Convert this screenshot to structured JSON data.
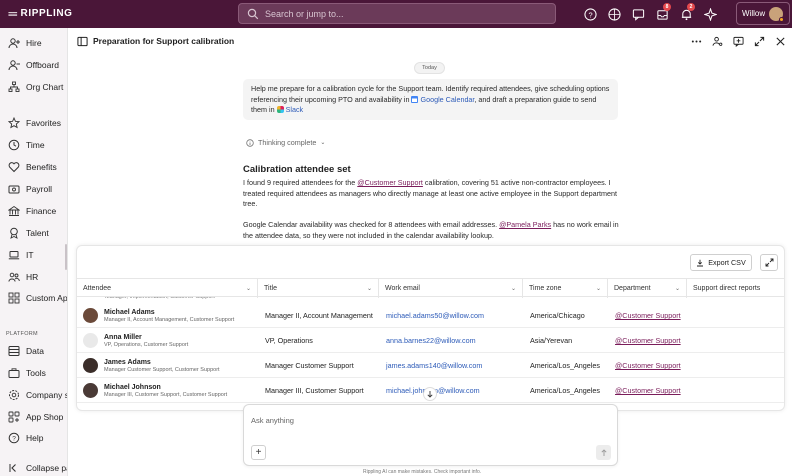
{
  "app": {
    "name": "RIPPLING",
    "logo_mark": "≡≡"
  },
  "search": {
    "placeholder": "Search or jump to..."
  },
  "top_icons": [
    {
      "icon": "help-icon"
    },
    {
      "icon": "globe-icon"
    },
    {
      "icon": "chat-icon"
    },
    {
      "icon": "inbox-icon",
      "badge": "8"
    },
    {
      "icon": "bell-icon",
      "badge": "2"
    },
    {
      "icon": "sparkle-icon"
    }
  ],
  "user": {
    "name": "Willow"
  },
  "sidebar": {
    "items": [
      {
        "label": "Hire",
        "icon": "hire-icon"
      },
      {
        "label": "Offboard",
        "icon": "offboard-icon"
      },
      {
        "label": "Org Chart",
        "icon": "org-chart-icon"
      },
      {
        "label": "Favorites",
        "icon": "star-icon"
      },
      {
        "label": "Time",
        "icon": "clock-icon"
      },
      {
        "label": "Benefits",
        "icon": "heart-icon"
      },
      {
        "label": "Payroll",
        "icon": "payroll-icon"
      },
      {
        "label": "Finance",
        "icon": "finance-icon"
      },
      {
        "label": "Talent",
        "icon": "talent-icon"
      },
      {
        "label": "IT",
        "icon": "laptop-icon"
      },
      {
        "label": "HR",
        "icon": "people-icon"
      },
      {
        "label": "Custom Apps",
        "icon": "grid-icon"
      }
    ],
    "platform_label": "PLATFORM",
    "platform_items": [
      {
        "label": "Data",
        "icon": "data-icon"
      },
      {
        "label": "Tools",
        "icon": "tools-icon"
      },
      {
        "label": "Company settings",
        "icon": "settings-icon"
      },
      {
        "label": "App Shop",
        "icon": "shop-icon"
      },
      {
        "label": "Help",
        "icon": "help-circle-icon"
      }
    ],
    "collapse_label": "Collapse panel"
  },
  "panel": {
    "title": "Preparation for Support calibration",
    "date_chip": "Today",
    "user_message": {
      "part1": "Help me prepare for a calibration cycle for the Support team. Identify required attendees, give scheduling options referencing their upcoming PTO and availability in ",
      "tag1": "Google Calendar",
      "part2": ", and draft a preparation guide to send them in ",
      "tag2": "Slack"
    },
    "thinking": "Thinking complete",
    "response": {
      "title": "Calibration attendee set",
      "p1_a": "I found 9 required attendees for the ",
      "p1_mention": "@Customer Support",
      "p1_b": " calibration, covering 51 active non-contractor employees. I treated required attendees as managers who directly manage at least one active employee in the Support department tree.",
      "p2_a": "Google Calendar availability was checked for 8 attendees with email addresses. ",
      "p2_mention": "@Pamela Parks",
      "p2_b": " has no work email in the attendee data, so they were not included in the calendar availability lookup."
    },
    "table": {
      "export_label": "Export CSV",
      "columns": [
        "Attendee",
        "Title",
        "Work email",
        "Time zone",
        "Department",
        "Support direct reports"
      ],
      "partial_row_sub": "Manager, Implementation, Customer Support",
      "rows": [
        {
          "name": "Michael Adams",
          "sub": "Manager II, Account Management, Customer Support",
          "title": "Manager II, Account Management",
          "email": "michael.adams50@willow.com",
          "tz": "America/Chicago",
          "dept": "@Customer Support",
          "avatar": "#6b4a3a"
        },
        {
          "name": "Anna Miller",
          "sub": "VP, Operations, Customer Support",
          "title": "VP, Operations",
          "email": "anna.barnes22@willow.com",
          "tz": "Asia/Yerevan",
          "dept": "@Customer Support",
          "avatar": "#e9e9e9"
        },
        {
          "name": "James Adams",
          "sub": "Manager Customer Support, Customer Support",
          "title": "Manager Customer Support",
          "email": "james.adams140@willow.com",
          "tz": "America/Los_Angeles",
          "dept": "@Customer Support",
          "avatar": "#3b2e2a"
        },
        {
          "name": "Michael Johnson",
          "sub": "Manager III, Customer Support, Customer Support",
          "title": "Manager III, Customer Support",
          "email": "michael.johnson@willow.com",
          "tz": "America/Los_Angeles",
          "dept": "@Customer Support",
          "avatar": "#4a3a36"
        }
      ]
    },
    "composer": {
      "placeholder": "Ask anything"
    },
    "disclaimer": "Rippling AI can make mistakes. Check important info."
  },
  "colors": {
    "topbar": "#4a1638",
    "mention": "#7a1c5a",
    "link": "#2d5bb8",
    "badge": "#e5484d"
  }
}
